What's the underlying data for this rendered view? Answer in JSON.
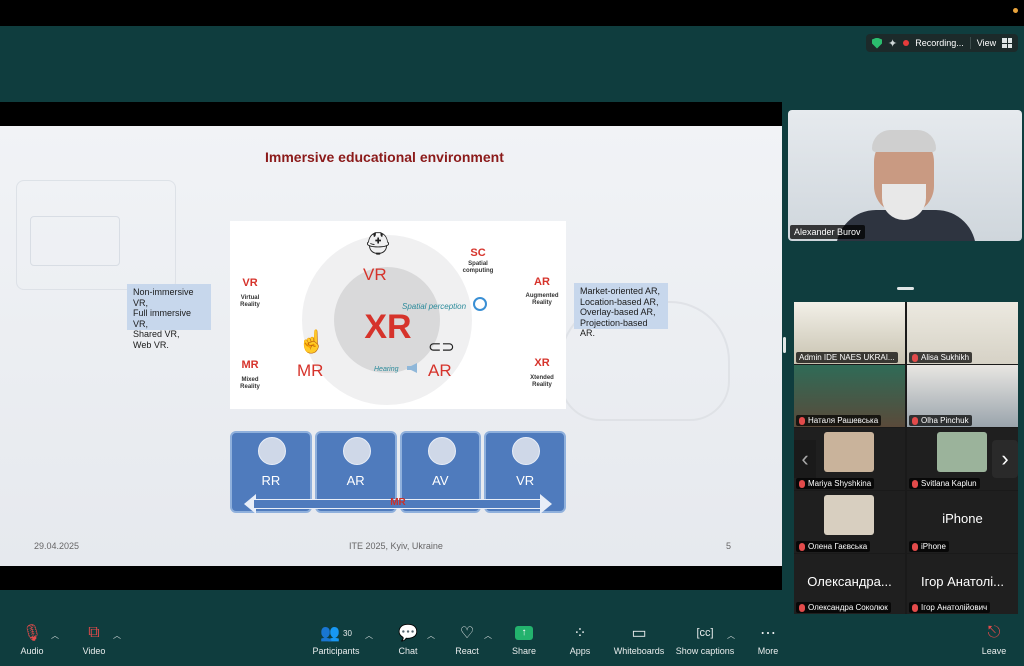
{
  "top_status": {
    "recording_label": "Recording...",
    "view_label": "View"
  },
  "slide": {
    "title": "Immersive educational environment",
    "left_note": [
      "Non-immersive VR,",
      "Full immersive VR,",
      "Shared VR,",
      "Web VR."
    ],
    "right_note": [
      "Market-oriented AR,",
      "Location-based AR,",
      "Overlay-based AR,",
      "Projection-based AR."
    ],
    "corner_labels": {
      "vr": {
        "code": "VR",
        "desc": [
          "Virtual",
          "Reality"
        ]
      },
      "mr": {
        "code": "MR",
        "desc": [
          "Mixed",
          "Reality"
        ]
      },
      "sc": {
        "code": "SC",
        "desc": [
          "Spatial",
          "computing"
        ]
      },
      "ar": {
        "code": "AR",
        "desc": [
          "Augmented",
          "Reality"
        ]
      },
      "xr": {
        "code": "XR",
        "desc": [
          "Xtended",
          "Reality"
        ]
      }
    },
    "ring_labels": {
      "vr": "VR",
      "mr": "MR",
      "ar": "AR"
    },
    "center_label": "XR",
    "spatial_perception": "Spatial perception",
    "hearing": "Hearing",
    "spectrum_boxes": [
      "RR",
      "AR",
      "AV",
      "VR"
    ],
    "spectrum_arrow_label": "MR",
    "footer_date": "29.04.2025",
    "footer_event": "ITE 2025, Kyiv, Ukraine",
    "footer_page": "5"
  },
  "speaker": {
    "name": "Alexander Burov"
  },
  "gallery": [
    {
      "name": "Admin IDE NAES UKRAI...",
      "kind": "video"
    },
    {
      "name": "Alisa Sukhikh",
      "kind": "video"
    },
    {
      "name": "Наталя Рашевська",
      "kind": "video"
    },
    {
      "name": "Olha Pinchuk",
      "kind": "video"
    },
    {
      "name": "Mariya Shyshkina",
      "kind": "avatar"
    },
    {
      "name": "Svitlana Kaplun",
      "kind": "avatar"
    },
    {
      "name": "Олена Гаєвська",
      "kind": "avatar"
    },
    {
      "name": "iPhone",
      "kind": "text",
      "display": "iPhone"
    },
    {
      "name": "Олександра Соколюк",
      "kind": "text",
      "display": "Олександра..."
    },
    {
      "name": "Ігор Анатолійович",
      "kind": "text",
      "display": "Ігор Анатолі..."
    }
  ],
  "toolbar": {
    "audio": "Audio",
    "video": "Video",
    "participants": "Participants",
    "participants_count": "30",
    "chat": "Chat",
    "react": "React",
    "share": "Share",
    "apps": "Apps",
    "whiteboards": "Whiteboards",
    "show_captions": "Show captions",
    "more": "More",
    "leave": "Leave"
  },
  "colors": {
    "background": "#0f3d3e",
    "accent_red": "#d6332b",
    "share_green": "#23b26d",
    "box_blue": "#4f7bbd"
  }
}
